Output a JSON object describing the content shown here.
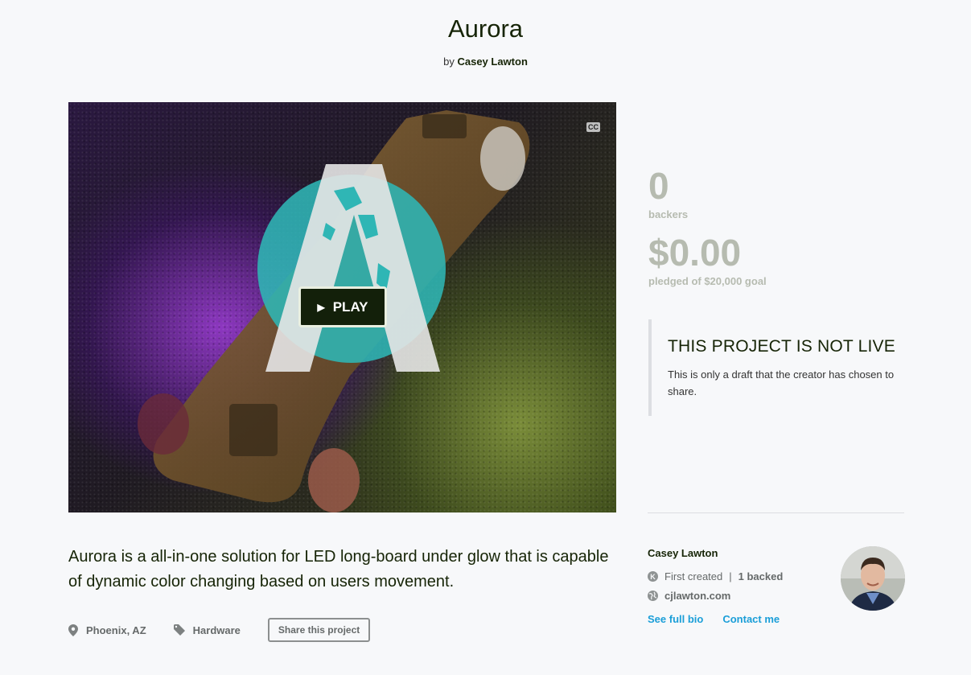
{
  "project": {
    "title": "Aurora",
    "by_prefix": "by",
    "creator": "Casey Lawton"
  },
  "video": {
    "play_label": "PLAY",
    "cc_label": "CC"
  },
  "stats": {
    "backers_count": "0",
    "backers_label": "backers",
    "pledged_amount": "$0.00",
    "pledged_label": "pledged of $20,000 goal"
  },
  "notice": {
    "heading": "THIS PROJECT IS NOT LIVE",
    "body": "This is only a draft that the creator has chosen to share."
  },
  "blurb": "Aurora is a all-in-one solution for LED long-board under glow that is capable of dynamic color changing based on users movement.",
  "meta": {
    "location": "Phoenix, AZ",
    "category": "Hardware",
    "share_label": "Share this project"
  },
  "creator_card": {
    "name": "Casey Lawton",
    "first_created": "First created",
    "separator": "|",
    "backed": "1 backed",
    "website": "cjlawton.com",
    "bio_link": "See full bio",
    "contact_link": "Contact me"
  },
  "colors": {
    "accent_link": "#1a9ed8",
    "stat_grey": "#b6bbb0",
    "play_button_bg": "#13200a",
    "logo_teal": "#2fb6b5"
  },
  "icons": {
    "location": "map-pin-icon",
    "category": "tag-icon",
    "kickstarter": "k-badge-icon",
    "website": "globe-icon",
    "play": "play-triangle-icon"
  }
}
